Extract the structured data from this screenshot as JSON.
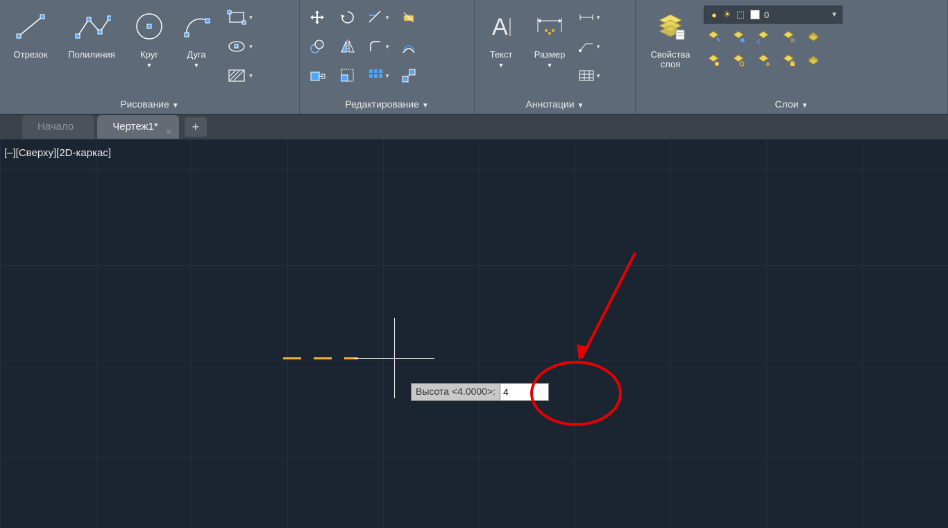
{
  "ribbon": {
    "draw_panel": {
      "title": "Рисование",
      "line": "Отрезок",
      "polyline": "Полилиния",
      "circle": "Круг",
      "arc": "Дуга"
    },
    "edit_panel": {
      "title": "Редактирование"
    },
    "anno_panel": {
      "title": "Аннотации",
      "text": "Текст",
      "dimension": "Размер"
    },
    "layers_panel": {
      "title": "Слои",
      "properties": "Свойства\nслоя",
      "current_layer": "0"
    }
  },
  "tabs": {
    "home": "Начало",
    "drawing": "Чертеж1*"
  },
  "viewport": {
    "label": "[–][Сверху][2D-каркас]"
  },
  "prompt": {
    "label": "Высота <4.0000>:",
    "value": "4"
  }
}
